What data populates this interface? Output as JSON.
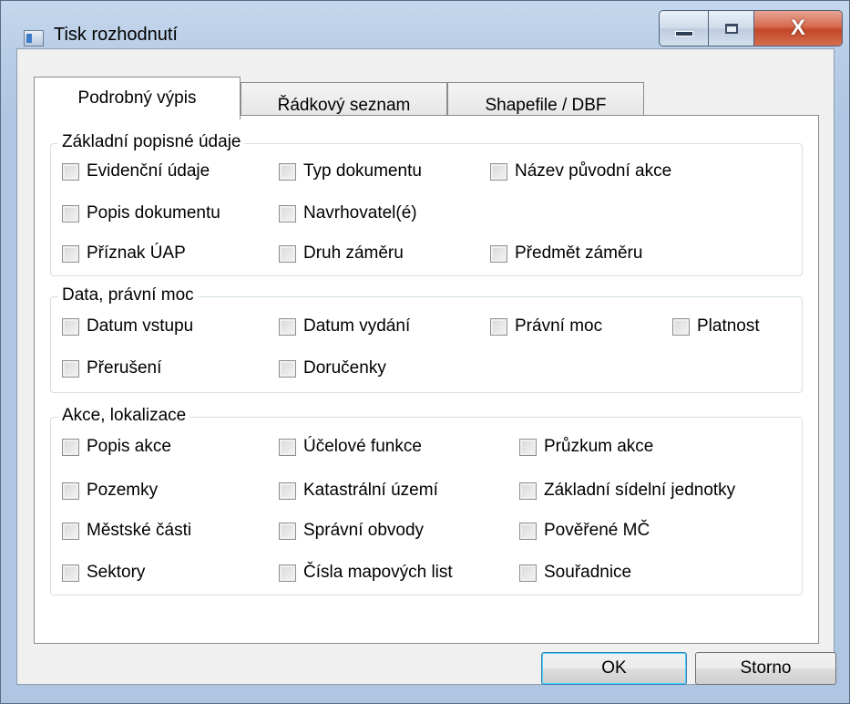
{
  "window": {
    "title": "Tisk rozhodnutí",
    "close_glyph": "X"
  },
  "tabs": [
    {
      "label": "Podrobný výpis",
      "active": true
    },
    {
      "label": "Řádkový seznam",
      "active": false
    },
    {
      "label": "Shapefile / DBF",
      "active": false
    }
  ],
  "groups": {
    "basic": {
      "title": "Základní popisné údaje",
      "items": [
        "Evidenční údaje",
        "Typ dokumentu",
        "Název původní akce",
        "Popis dokumentu",
        "Navrhovatel(é)",
        "Příznak ÚAP",
        "Druh záměru",
        "Předmět záměru"
      ]
    },
    "dates": {
      "title": "Data, právní moc",
      "items": [
        "Datum vstupu",
        "Datum vydání",
        "Právní moc",
        "Platnost",
        "Přerušení",
        "Doručenky"
      ]
    },
    "actions": {
      "title": "Akce, lokalizace",
      "items": [
        "Popis akce",
        "Účelové funkce",
        "Průzkum akce",
        "Pozemky",
        "Katastrální území",
        "Základní sídelní jednotky",
        "Městské části",
        "Správní obvody",
        "Pověřené MČ",
        "Sektory",
        "Čísla mapových list",
        "Souřadnice"
      ]
    }
  },
  "buttons": {
    "ok": "OK",
    "cancel": "Storno"
  },
  "icons": {
    "app": "app-window-icon",
    "minimize": "minimize-icon",
    "maximize": "maximize-icon",
    "close": "close-icon"
  }
}
